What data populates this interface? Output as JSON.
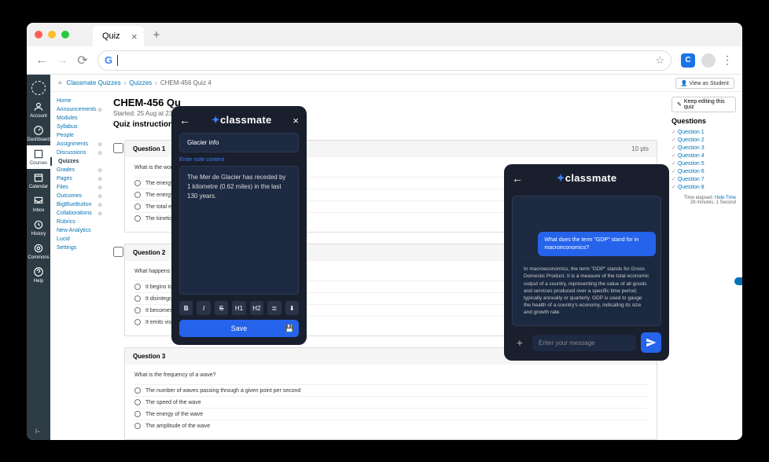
{
  "browser": {
    "tab_title": "Quiz"
  },
  "breadcrumbs": {
    "a": "Classmate Quizzes",
    "b": "Quizzes",
    "c": "CHEM-456 Quiz 4"
  },
  "view_as": "View as Student",
  "rail": {
    "account": "Account",
    "dashboard": "Dashboard",
    "courses": "Courses",
    "calendar": "Calendar",
    "inbox": "Inbox",
    "history": "History",
    "commons": "Commons",
    "help": "Help"
  },
  "coursenav": {
    "home": "Home",
    "announcements": "Announcements",
    "modules": "Modules",
    "syllabus": "Syllabus",
    "people": "People",
    "assignments": "Assignments",
    "discussions": "Discussions",
    "quizzes": "Quizzes",
    "grades": "Grades",
    "pages": "Pages",
    "files": "Files",
    "outcomes": "Outcomes",
    "bbb": "BigBlueButton",
    "collaborations": "Collaborations",
    "rubrics": "Rubrics",
    "new_analytics": "New Analytics",
    "lucid": "Lucid",
    "settings": "Settings"
  },
  "quiz": {
    "title": "CHEM-456 Qu",
    "started": "Started: 25 Aug at 23:01",
    "instructions": "Quiz instruction",
    "keep_editing": "Keep editing this quiz",
    "q1": {
      "label": "Question 1",
      "pts": "10 pts",
      "prompt": "What is the work",
      "o1": "The energy requi",
      "o2": "The energy requir",
      "o3": "The total energy",
      "o4": "The kinetic ener"
    },
    "q2": {
      "label": "Question 2",
      "prompt": "What happens wh",
      "o1": "It begins to vapo",
      "o2": "It disintegrates",
      "o3": "It becomes liquid",
      "o4": "It emits visible lig"
    },
    "q3": {
      "label": "Question 3",
      "prompt": "What is the frequency of a wave?",
      "o1": "The number of waves passing through a given point per second",
      "o2": "The speed of the wave",
      "o3": "The energy of the wave",
      "o4": "The amplitude of the wave"
    }
  },
  "sidebar": {
    "questions_header": "Questions",
    "q1": "Question 1",
    "q2": "Question 2",
    "q3": "Question 3",
    "q4": "Question 4",
    "q5": "Question 5",
    "q6": "Question 6",
    "q7": "Question 7",
    "q8": "Question 8",
    "time_elapsed": "Time elapsed:",
    "hide_time": "Hide Time",
    "time_value": "28 minutes, 1 Second"
  },
  "popup1": {
    "brand": "classmate",
    "title_value": "Glacier info",
    "enter_note": "Enter note content",
    "body": "The Mer de Glacier has receded by 1 kilometre (0.62 miles) in the last 130 years.",
    "save": "Save",
    "tb_b": "B",
    "tb_i": "I",
    "tb_s": "S",
    "tb_h1": "H1",
    "tb_h2": "H2"
  },
  "popup2": {
    "brand": "classmate",
    "user_msg": "What does the term \"GDP\" stand for in macroeconomics?",
    "asst_msg": "In macroeconomics, the term \"GDP\" stands for Gross Domestic Product. It is a measure of the total economic output of a country, representing the value of all goods and services produced over a specific time period, typically annually or quarterly. GDP is used to gauge the health of a country's economy, indicating its size and growth rate.",
    "placeholder": "Enter your message"
  }
}
